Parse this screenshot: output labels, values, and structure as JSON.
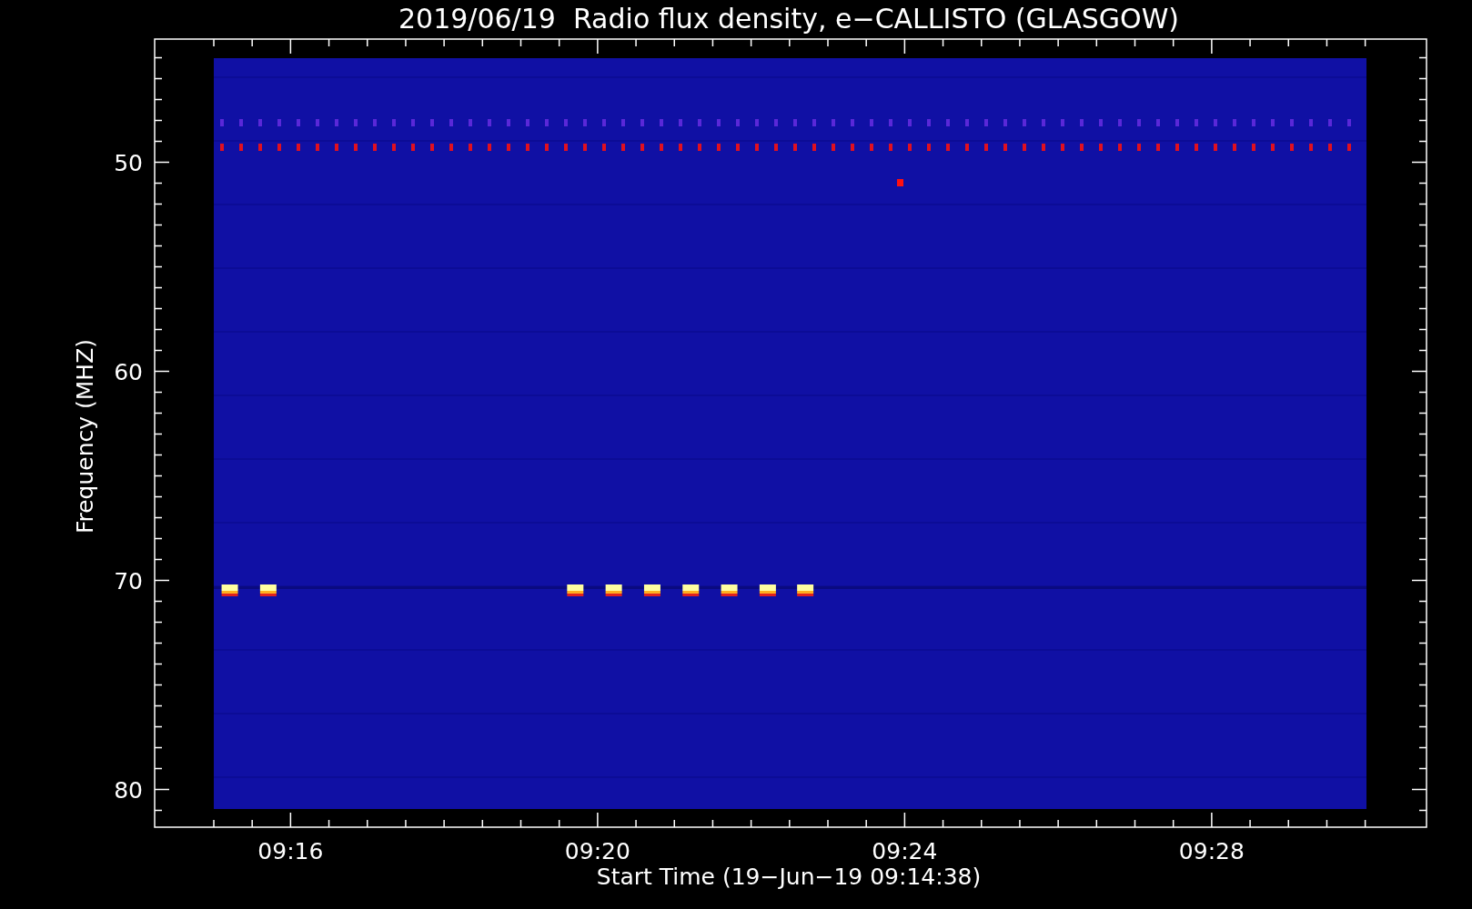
{
  "title": "2019/06/19  Radio flux density, e−CALLISTO (GLASGOW)",
  "y_axis": {
    "label": "Frequency (MHZ)",
    "ticks": [
      "50",
      "60",
      "70",
      "80"
    ]
  },
  "x_axis": {
    "label": "Start Time (19−Jun−19 09:14:38)",
    "ticks": [
      "09:16",
      "09:20",
      "09:24",
      "09:28"
    ]
  }
}
